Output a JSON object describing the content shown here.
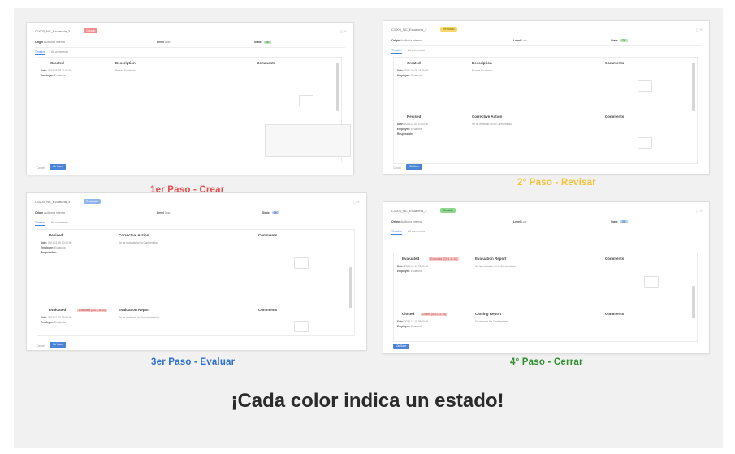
{
  "colors": {
    "crear": "#e8504f",
    "revisar": "#f2c23a",
    "evaluar": "#2d6fcf",
    "cerrar": "#2f8f2f",
    "primary_button": "#4b83d8"
  },
  "captions": {
    "step1": "1er Paso - Crear",
    "step2": "2° Paso - Revisar",
    "step3": "3er Paso - Evaluar",
    "step4": "4° Paso - Cerrar"
  },
  "headline": "¡Cada color indica un estado!",
  "shots": {
    "s1": {
      "window_title": "C1003_NC_Ecuatoria_3",
      "status_badge": "Creado",
      "labels": {
        "origin": "Origin",
        "level": "Level",
        "state": "State"
      },
      "values": {
        "origin": "Auditoría interna",
        "level": "Low",
        "state_chip": "OK"
      },
      "tabs": [
        "Timeline",
        "All comments"
      ],
      "section1": {
        "headers": [
          "Created",
          "Description",
          "Comments"
        ],
        "date": "2021-05-25 11:00:00",
        "employee": "Ecuatoria",
        "description": "Prueba Ecuatoria"
      },
      "buttons": {
        "cancel": "Cancel",
        "primary": "Ok Save"
      }
    },
    "s2": {
      "window_title": "C1003_NC_Ecuatoria_3",
      "status_badge": "Revisado",
      "labels": {
        "origin": "Origin",
        "level": "Level",
        "state": "State"
      },
      "values": {
        "origin": "Auditoría interna",
        "level": "Low",
        "state_chip": "OK"
      },
      "tabs": [
        "Timeline",
        "All comments"
      ],
      "section1": {
        "headers": [
          "Created",
          "Description",
          "Comments"
        ],
        "date": "2021-05-05 11:00:00",
        "employee": "Ecuatoria",
        "description": "Prueba Ecuatoria"
      },
      "section2": {
        "headers": [
          "Revised",
          "Corrective Action",
          "Comments"
        ],
        "date": "2021-11-05 10:00:00",
        "employee": "Ecuatoria",
        "responsible": "",
        "description": "Se ha revisado la No Conformidad"
      },
      "buttons": {
        "cancel": "Cancel",
        "primary": "Ok Save"
      }
    },
    "s3": {
      "window_title": "C1003_NC_Ecuatoria_3",
      "status_badge": "Evaluado",
      "labels": {
        "origin": "Origin",
        "level": "Level",
        "state": "State"
      },
      "values": {
        "origin": "Auditoría interna",
        "level": "Low",
        "state_chip": "OK"
      },
      "tabs": [
        "Timeline",
        "All comments"
      ],
      "section1": {
        "headers": [
          "Revised",
          "Corrective Action",
          "Comments"
        ],
        "date": "2021-11-05 10:00:00",
        "employee": "Ecuatoria",
        "responsible": "",
        "description": "Se ha revisado la No Conformidad"
      },
      "section2": {
        "headers": [
          "Evaluated",
          "Evaluation Report",
          "Comments"
        ],
        "tag": "Evaluated (2021-11-10)",
        "date": "2021-11-10 09:00:00",
        "employee": "Ecuatoria",
        "description": "Se ha evaluado la No Conformidad"
      },
      "buttons": {
        "cancel": "Cancel",
        "primary": "Ok Save"
      }
    },
    "s4": {
      "window_title": "C1003_NC_Ecuatoria_3",
      "status_badge": "Cerrado",
      "labels": {
        "origin": "Origin",
        "level": "Level",
        "state": "State"
      },
      "values": {
        "origin": "Auditoría interna",
        "level": "Low",
        "state_chip": "OK"
      },
      "tabs": [
        "Timeline",
        "All comments"
      ],
      "section1": {
        "headers": [
          "Evaluated",
          "Evaluation Report",
          "Comments"
        ],
        "tag": "Evaluated (2021-11-10)",
        "date": "2021-11-10 09:00:00",
        "employee": "Ecuatoria",
        "description": "Se ha evaluado la No Conformidad"
      },
      "section2": {
        "headers": [
          "Closed",
          "Closing Report",
          "Comments"
        ],
        "tag": "Closed (2021-11-15)",
        "date": "2021-11-15 09:00:00",
        "employee": "Ecuatoria",
        "description": "Se cierra la No Conformidad"
      },
      "buttons": {
        "primary": "Ok Save"
      }
    }
  }
}
